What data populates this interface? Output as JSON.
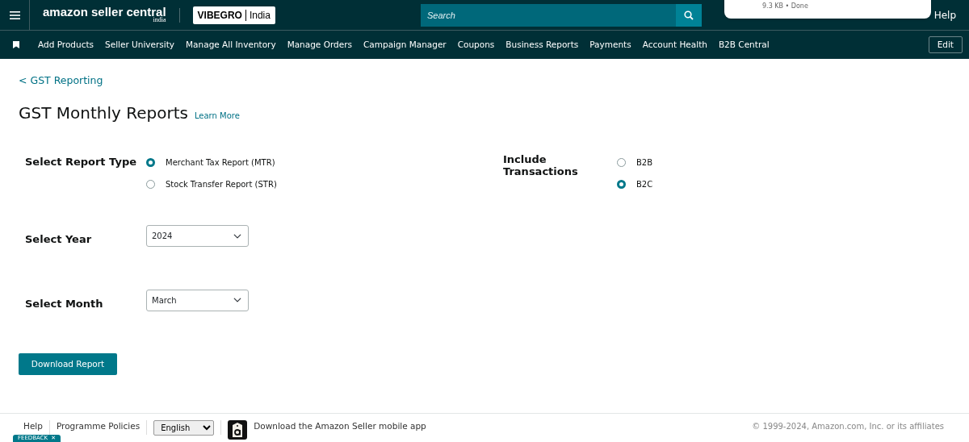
{
  "header": {
    "logo": "amazon seller central",
    "logo_region": "india",
    "store": "VIBEGRO",
    "store_region": "India",
    "search": {
      "placeholder": "Search"
    },
    "help": "Help"
  },
  "download_popup": {
    "status": "9.3 KB • Done"
  },
  "nav": {
    "items": [
      "Add Products",
      "Seller University",
      "Manage All Inventory",
      "Manage Orders",
      "Campaign Manager",
      "Coupons",
      "Business Reports",
      "Payments",
      "Account Health",
      "B2B Central"
    ],
    "edit": "Edit"
  },
  "back_link": "< GST Reporting",
  "title": "GST Monthly Reports",
  "learn_more": "Learn More",
  "report_type": {
    "label": "Select Report Type",
    "options": [
      {
        "label": "Merchant Tax Report (MTR)",
        "selected": true
      },
      {
        "label": "Stock Transfer Report (STR)",
        "selected": false
      }
    ]
  },
  "transactions": {
    "label": "Include Transactions",
    "options": [
      {
        "label": "B2B",
        "selected": false
      },
      {
        "label": "B2C",
        "selected": true
      }
    ]
  },
  "year": {
    "label": "Select Year",
    "value": "2024"
  },
  "month": {
    "label": "Select Month",
    "value": "March"
  },
  "download_button": "Download Report",
  "footer": {
    "links": [
      "Help",
      "Programme Policies"
    ],
    "language": "English",
    "app_text": "Download the Amazon Seller mobile app",
    "copyright": "© 1999-2024, Amazon.com, Inc. or its affiliates"
  },
  "feedback": {
    "label": "FEEDBACK",
    "close": "✕"
  }
}
